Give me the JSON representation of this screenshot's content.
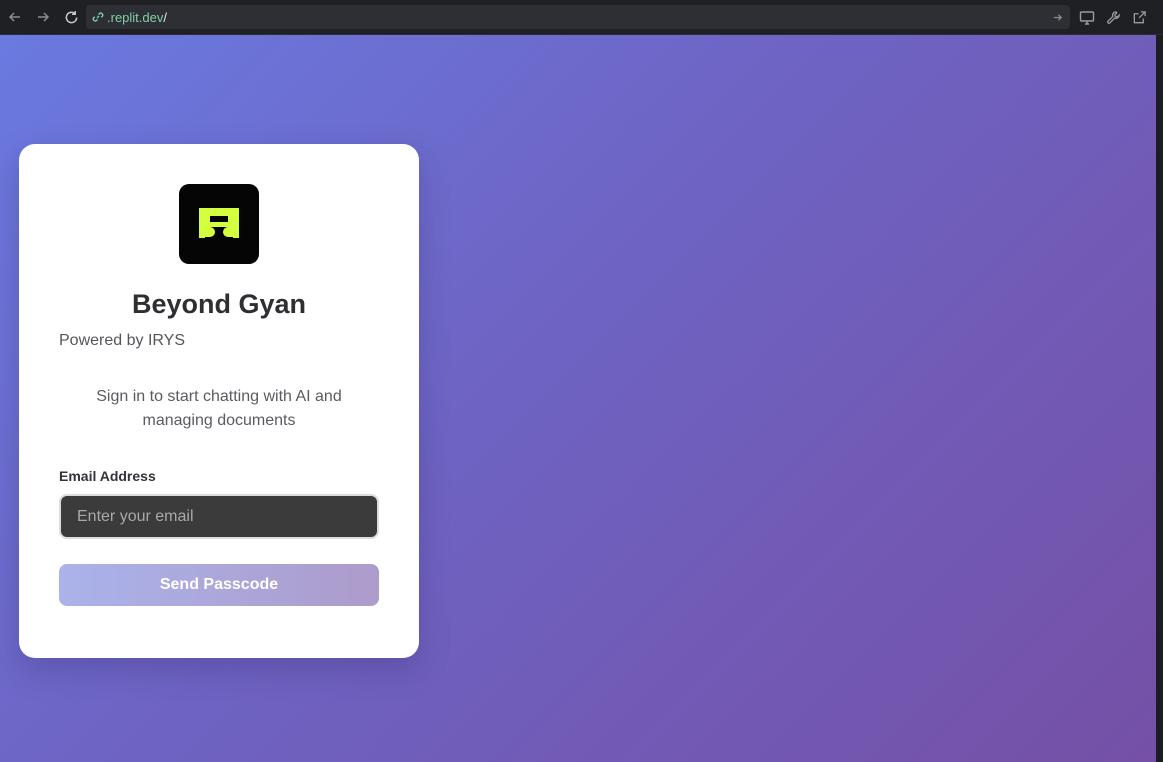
{
  "browser": {
    "url_domain": ".replit.dev",
    "url_path": "/"
  },
  "card": {
    "logo_icon": "beyond-gyan-logo",
    "title": "Beyond Gyan",
    "powered_by": "Powered by IRYS",
    "subtitle": "Sign in to start chatting with AI and managing documents",
    "email_label": "Email Address",
    "email_placeholder": "Enter your email",
    "email_value": "",
    "send_button_label": "Send Passcode"
  },
  "colors": {
    "logo_accent": "#d4ff3f",
    "gradient_start": "#6a7ae0",
    "gradient_end": "#7550a6"
  }
}
